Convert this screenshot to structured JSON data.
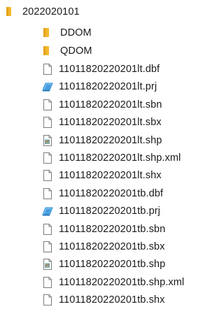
{
  "tree": {
    "root": {
      "label": "2022020101",
      "icon": "folder-icon"
    },
    "folders": [
      {
        "label": "DDOM",
        "icon": "folder-icon"
      },
      {
        "label": "QDOM",
        "icon": "folder-icon"
      }
    ],
    "files": [
      {
        "label": "11011820220201lt.dbf",
        "icon": "file-icon"
      },
      {
        "label": "11011820220201lt.prj",
        "icon": "projection-file-icon"
      },
      {
        "label": "11011820220201lt.sbn",
        "icon": "file-icon"
      },
      {
        "label": "11011820220201lt.sbx",
        "icon": "file-icon"
      },
      {
        "label": "11011820220201lt.shp",
        "icon": "shapefile-icon"
      },
      {
        "label": "11011820220201lt.shp.xml",
        "icon": "file-icon"
      },
      {
        "label": "11011820220201lt.shx",
        "icon": "file-icon"
      },
      {
        "label": "11011820220201tb.dbf",
        "icon": "file-icon"
      },
      {
        "label": "11011820220201tb.prj",
        "icon": "projection-file-icon"
      },
      {
        "label": "11011820220201tb.sbn",
        "icon": "file-icon"
      },
      {
        "label": "11011820220201tb.sbx",
        "icon": "file-icon"
      },
      {
        "label": "11011820220201tb.shp",
        "icon": "shapefile-icon"
      },
      {
        "label": "11011820220201tb.shp.xml",
        "icon": "file-icon"
      },
      {
        "label": "11011820220201tb.shx",
        "icon": "file-icon"
      }
    ]
  },
  "colors": {
    "folder": "#f3b72c",
    "file_outline": "#7d7d7d",
    "prj_accent": "#2f8fd6",
    "text": "#1a1a1a"
  }
}
